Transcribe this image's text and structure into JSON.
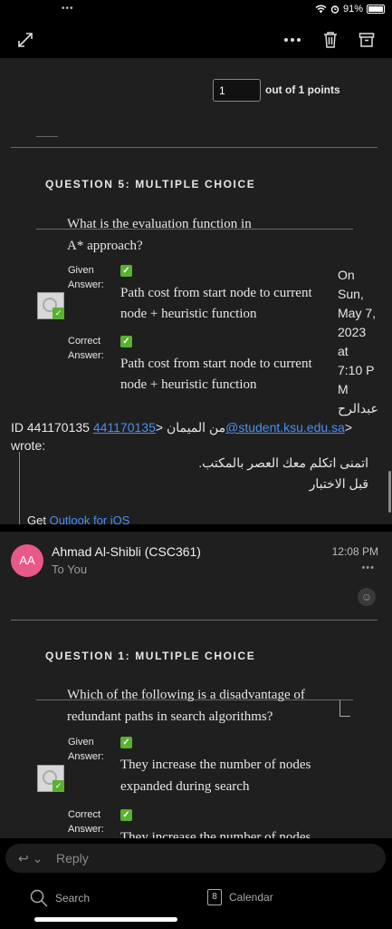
{
  "status": {
    "dots": "•••",
    "battery": "91%"
  },
  "toolbar": {
    "expand_icon": "expand-icon",
    "more_icon": "more-icon",
    "delete_icon": "trash-icon",
    "archive_icon": "archive-icon"
  },
  "q4": {
    "points_value": "1",
    "points_label": "out of 1 points"
  },
  "q5": {
    "header": "QUESTION 5:   MULTIPLE CHOICE",
    "question_line1": "What is the evaluation function in",
    "question_line2": "A* approach?",
    "given_label1": "Given",
    "given_label2": "Answer:",
    "given_answer1": "Path cost from start node to current",
    "given_answer2": "node + heuristic function",
    "correct_label1": "Correct",
    "correct_label2": "Answer:",
    "correct_answer1": "Path cost from start node to current",
    "correct_answer2": "node + heuristic function"
  },
  "date_block": [
    "On",
    "Sun,",
    "May 7,",
    "2023",
    "at",
    "7:10 P",
    "M",
    "عبدالرح"
  ],
  "wrote": {
    "prefix": "ID 441170135 من الميمان <",
    "email": "441170135@student.ksu.edu.sa",
    "suffix": ">",
    "line2": "wrote:"
  },
  "quoted": {
    "line1": "اتمنى اتكلم معك العصر بالمكتب.",
    "line2": "قبل الاختبار",
    "get_prefix": "Get ",
    "get_link": "Outlook for iOS"
  },
  "message2": {
    "avatar": "AA",
    "sender": "Ahmad Al-Shibli (CSC361)",
    "to": "To You",
    "time": "12:08 PM",
    "more": "•••"
  },
  "q1": {
    "header": "QUESTION 1:   MULTIPLE CHOICE",
    "question_line1": "Which of the following is a disadvantage of",
    "question_line2": "redundant paths in search algorithms?",
    "given_label1": "Given",
    "given_label2": "Answer:",
    "given_answer1": "They increase the number of nodes",
    "given_answer2": "expanded during search",
    "correct_label1": "Correct",
    "correct_label2": "Answer:",
    "correct_answer1": "They increase the number of nodes"
  },
  "reply": {
    "label": "Reply"
  },
  "tabs": {
    "search": "Search",
    "calendar": "Calendar",
    "calendar_day": "8"
  },
  "colors": {
    "accent": "#4b8ef0",
    "avatar": "#e8598a",
    "check": "#5ab130",
    "background": "#1f1f1f"
  }
}
